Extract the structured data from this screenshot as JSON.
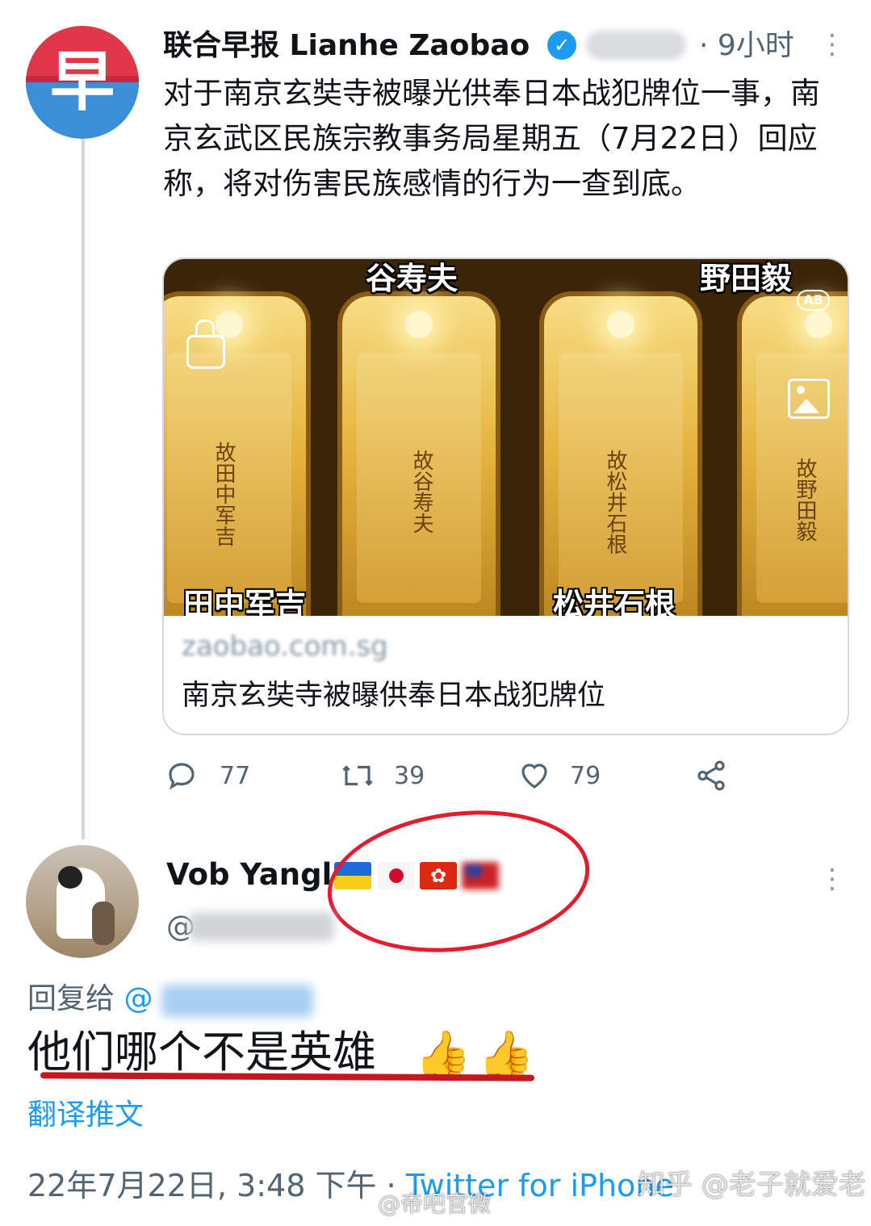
{
  "tweet": {
    "author_name": "联合早报 Lianhe Zaobao",
    "time": "· 9小时",
    "text": "对于南京玄奘寺被曝光供奉日本战犯牌位一事，南京玄武区民族宗教事务局星期五（7月22日）回应称，将对伤害民族感情的行为一查到底。",
    "avatar_glyph": "早",
    "more_icon": "⋮",
    "card": {
      "image_captions": {
        "top_center": "谷寿夫",
        "top_right": "野田毅",
        "bottom_left": "田中军吉",
        "bottom_right": "松井石根"
      },
      "plaque_texts": [
        "故田中军吉",
        "故谷寿夫",
        "故松井石根",
        "故野田毅"
      ],
      "ab_badge": "AB",
      "domain": "zaobao.com.sg",
      "title": "南京玄奘寺被曝供奉日本战犯牌位"
    },
    "actions": {
      "reply_count": "77",
      "retweet_count": "39",
      "like_count": "79"
    },
    "icons": {
      "reply": "reply-icon",
      "retweet": "retweet-icon",
      "like": "heart-icon",
      "share": "share-icon"
    }
  },
  "reply": {
    "author_name": "Vob Yangl",
    "handle_prefix": "@",
    "hk_flag_glyph": "✿",
    "more_icon": "⋮",
    "reply_to_label": "回复给",
    "reply_to_at": "@",
    "text": "他们哪个不是英雄",
    "emoji": "👍",
    "translate": "翻译推文",
    "date": "22年7月22日, 3:48 下午 · ",
    "source": "Twitter for iPhone"
  },
  "watermarks": {
    "zhihu": "知乎 @老子就爱老",
    "weibo": "@帝吧官微"
  },
  "colors": {
    "accent": "#1d9bf0",
    "secondary_text": "#536471",
    "annotation_red": "#e31d2d"
  }
}
